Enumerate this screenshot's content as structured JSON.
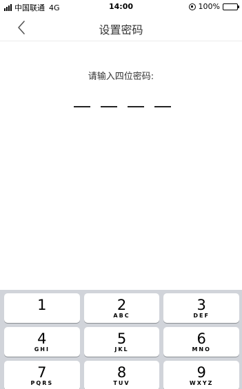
{
  "status_bar": {
    "carrier": "中国联通",
    "network": "4G",
    "time": "14:00",
    "battery": "100%",
    "icons": [
      "signal-icon",
      "orientation-lock-icon",
      "battery-icon"
    ]
  },
  "nav": {
    "title": "设置密码",
    "back_icon": "chevron-left-icon"
  },
  "main": {
    "prompt": "请输入四位密码:",
    "pin_length": 4,
    "entered_digits": 0
  },
  "keypad": {
    "rows": [
      [
        {
          "digit": "1",
          "letters": ""
        },
        {
          "digit": "2",
          "letters": "ABC"
        },
        {
          "digit": "3",
          "letters": "DEF"
        }
      ],
      [
        {
          "digit": "4",
          "letters": "GHI"
        },
        {
          "digit": "5",
          "letters": "JKL"
        },
        {
          "digit": "6",
          "letters": "MNO"
        }
      ],
      [
        {
          "digit": "7",
          "letters": "PQRS"
        },
        {
          "digit": "8",
          "letters": "TUV"
        },
        {
          "digit": "9",
          "letters": "WXYZ"
        }
      ]
    ]
  },
  "colors": {
    "keypad_bg": "#d1d4da",
    "key_bg": "#ffffff",
    "text": "#333333"
  }
}
